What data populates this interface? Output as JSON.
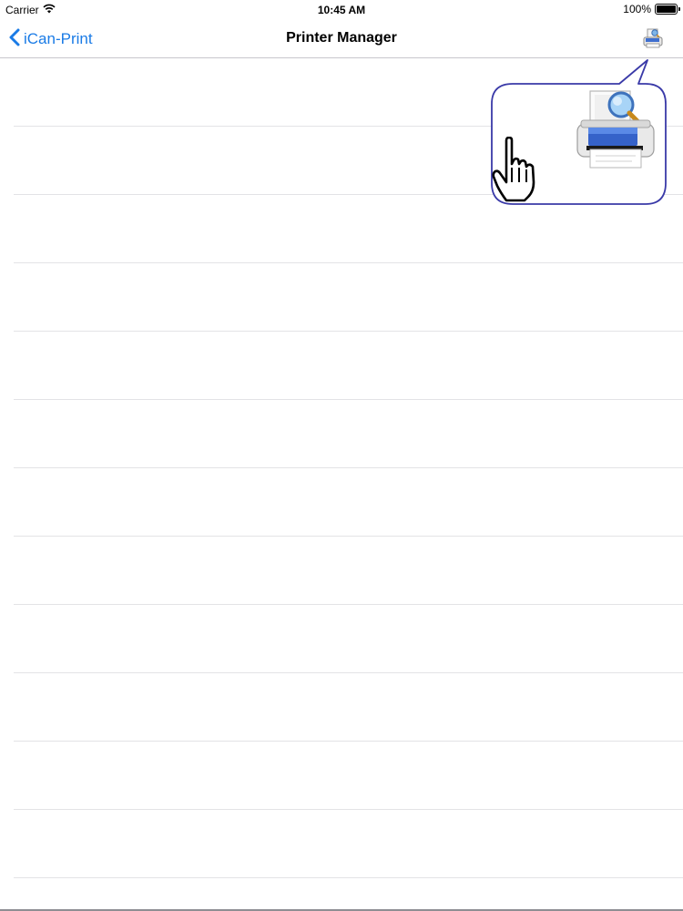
{
  "status_bar": {
    "carrier": "Carrier",
    "time": "10:45 AM",
    "battery": "100%",
    "battery_level": 1.0
  },
  "nav": {
    "back_label": "iCan-Print",
    "title": "Printer Manager",
    "back_icon": "chevron-left-icon",
    "action_icon": "printer-search-icon"
  },
  "colors": {
    "accent": "#1a7be6",
    "callout_border": "#3a3aa8",
    "separator": "#e3e3e6"
  },
  "rows": [
    {},
    {},
    {},
    {},
    {},
    {},
    {},
    {},
    {},
    {},
    {},
    {}
  ]
}
